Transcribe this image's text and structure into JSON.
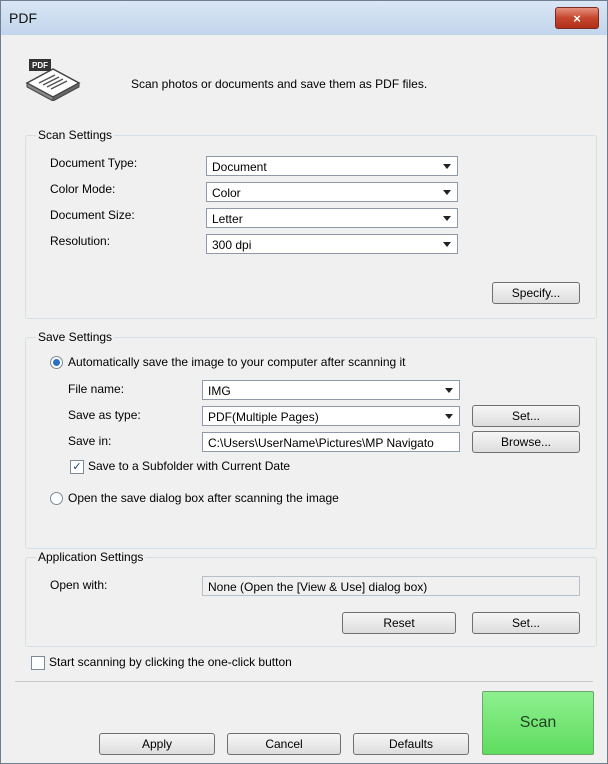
{
  "window": {
    "title": "PDF",
    "close_label": "×"
  },
  "header": {
    "description": "Scan photos or documents and save them as PDF files."
  },
  "scan_settings": {
    "legend": "Scan Settings",
    "document_type": {
      "label": "Document Type:",
      "value": "Document"
    },
    "color_mode": {
      "label": "Color Mode:",
      "value": "Color"
    },
    "document_size": {
      "label": "Document Size:",
      "value": "Letter"
    },
    "resolution": {
      "label": "Resolution:",
      "value": "300 dpi"
    },
    "specify_label": "Specify..."
  },
  "save_settings": {
    "legend": "Save Settings",
    "auto_save_label": "Automatically save the image to your computer after scanning it",
    "file_name": {
      "label": "File name:",
      "value": "IMG"
    },
    "save_as_type": {
      "label": "Save as type:",
      "value": "PDF(Multiple Pages)"
    },
    "set_label": "Set...",
    "save_in": {
      "label": "Save in:",
      "value": "C:\\Users\\UserName\\Pictures\\MP Navigato"
    },
    "browse_label": "Browse...",
    "subfolder_label": "Save to a Subfolder with Current Date",
    "open_dialog_label": "Open the save dialog box after scanning the image"
  },
  "app_settings": {
    "legend": "Application Settings",
    "open_with_label": "Open with:",
    "open_with_value": "None (Open the [View & Use] dialog box)",
    "reset_label": "Reset",
    "set_label": "Set..."
  },
  "one_click_label": "Start scanning by clicking the one-click button",
  "footer": {
    "apply_label": "Apply",
    "cancel_label": "Cancel",
    "defaults_label": "Defaults",
    "scan_label": "Scan"
  }
}
